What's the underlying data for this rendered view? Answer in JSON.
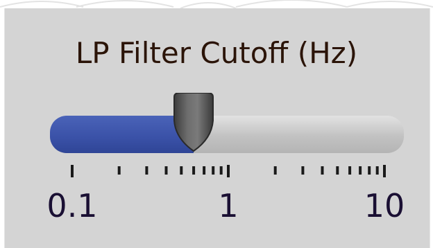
{
  "control": {
    "label": "LP Filter Cutoff (Hz)",
    "value_hz": 0.6,
    "scale": "log",
    "min": 0.1,
    "max": 10,
    "major_ticks": [
      {
        "value": 0.1,
        "label": "0.1"
      },
      {
        "value": 1,
        "label": "1"
      },
      {
        "value": 10,
        "label": "10"
      }
    ],
    "minor_ticks": [
      0.2,
      0.3,
      0.4,
      0.5,
      0.6,
      0.7,
      0.8,
      0.9,
      2,
      3,
      4,
      5,
      6,
      7,
      8,
      9
    ]
  },
  "colors": {
    "panel": "#d4d4d4",
    "fill": "#3a51a7",
    "track": "#c8c8c8",
    "thumb": "#555555",
    "label": "#2b1408"
  }
}
